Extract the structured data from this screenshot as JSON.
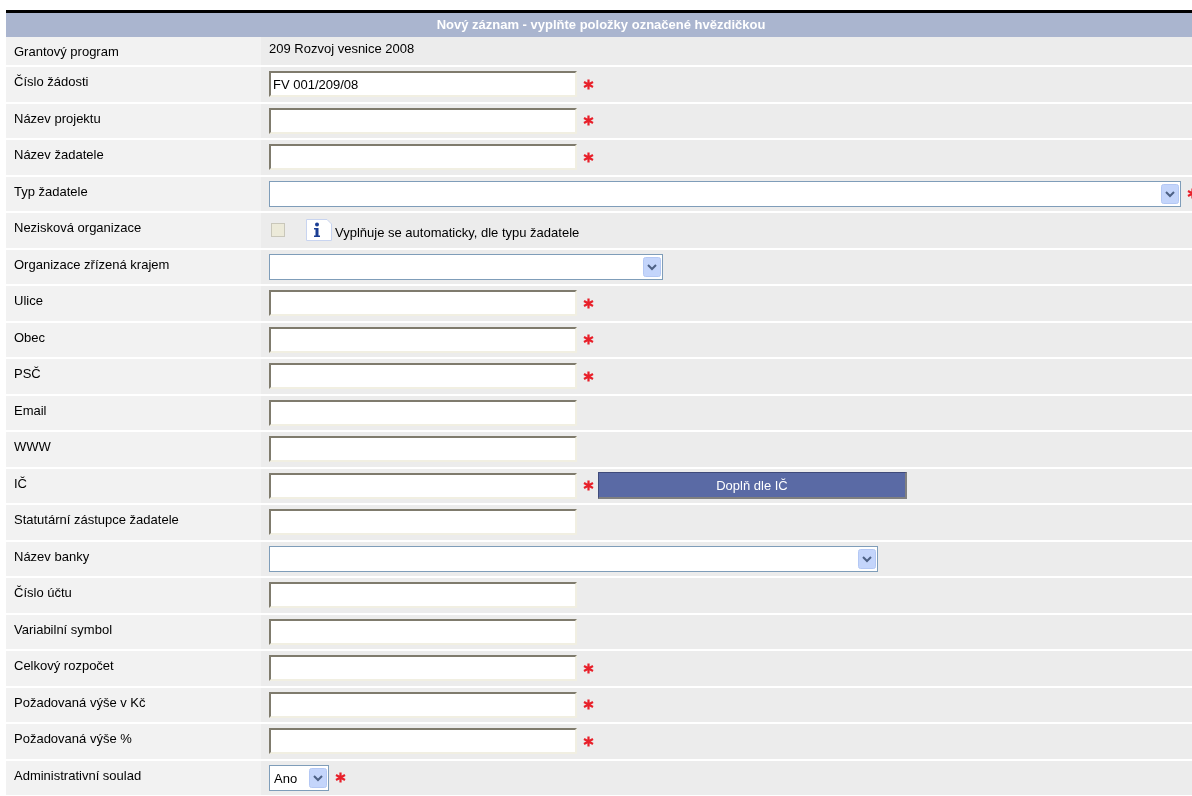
{
  "form": {
    "title": "Nový záznam - vyplňte položky označené hvězdičkou",
    "rows": [
      {
        "label": "Grantový program",
        "kind": "static",
        "value": "209 Rozvoj vesnice 2008"
      },
      {
        "label": "Číslo žádosti",
        "kind": "text",
        "value": "FV 001/209/08",
        "required": true
      },
      {
        "label": "Název projektu",
        "kind": "text",
        "required": true
      },
      {
        "label": "Název žadatele",
        "kind": "text",
        "required": true
      },
      {
        "label": "Typ žadatele",
        "kind": "select",
        "required": true
      },
      {
        "label": "Nezisková organizace",
        "kind": "checkbox",
        "checked": false,
        "disabled": true,
        "note": "Vyplňuje se automaticky, dle typu žadatele"
      },
      {
        "label": "Organizace zřízená krajem",
        "kind": "select",
        "required": false
      },
      {
        "label": "Ulice",
        "kind": "text",
        "required": true
      },
      {
        "label": "Obec",
        "kind": "text",
        "required": true
      },
      {
        "label": "PSČ",
        "kind": "text",
        "required": true
      },
      {
        "label": "Email",
        "kind": "text",
        "required": false
      },
      {
        "label": "WWW",
        "kind": "text",
        "required": false
      },
      {
        "label": "IČ",
        "kind": "text",
        "required": true,
        "button": "Doplň dle IČ"
      },
      {
        "label": "Statutární zástupce žadatele",
        "kind": "text",
        "required": false
      },
      {
        "label": "Název banky",
        "kind": "select",
        "required": false
      },
      {
        "label": "Číslo účtu",
        "kind": "text",
        "required": false
      },
      {
        "label": "Variabilní symbol",
        "kind": "text",
        "required": false
      },
      {
        "label": "Celkový rozpočet",
        "kind": "text",
        "required": true
      },
      {
        "label": "Požadovaná výše v Kč",
        "kind": "text",
        "required": true
      },
      {
        "label": "Požadovaná výše %",
        "kind": "text",
        "required": true
      },
      {
        "label": "Administrativní soulad",
        "kind": "select",
        "value": "Ano",
        "required": true
      }
    ]
  }
}
